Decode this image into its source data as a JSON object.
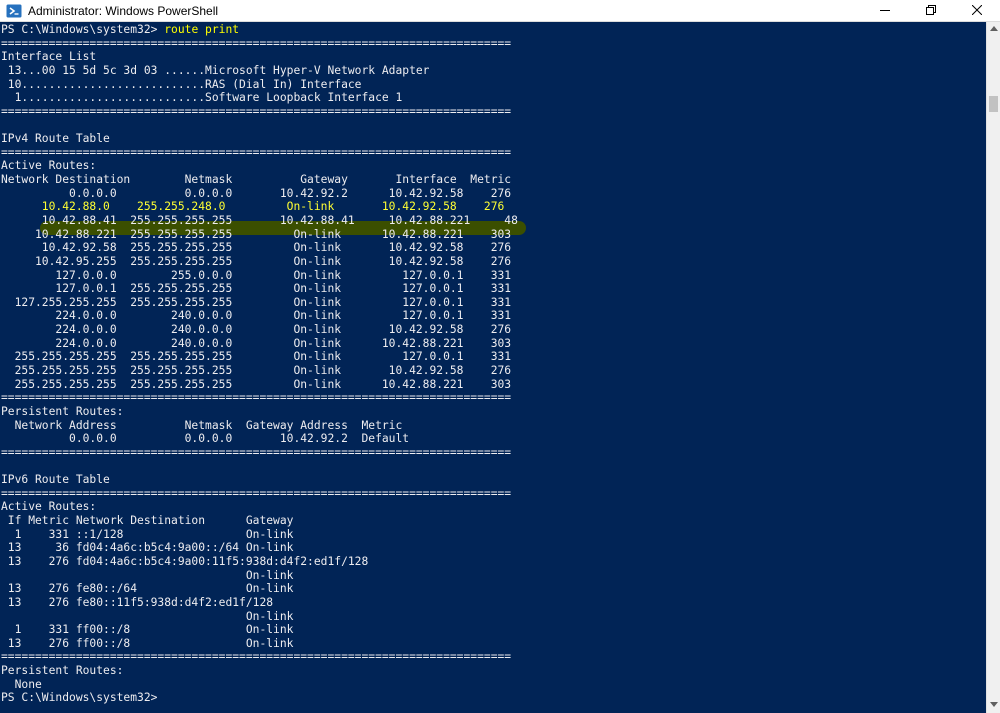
{
  "window": {
    "title": "Administrator: Windows PowerShell",
    "icon": "powershell-icon",
    "controls": [
      "minimize-icon",
      "maximize-icon",
      "close-icon"
    ]
  },
  "colors": {
    "console_bg": "#012456",
    "console_fg": "#eeedf0",
    "command": "#ffff00",
    "highlight_bg": "#3a4e00",
    "highlight_fg": "#ffff33"
  },
  "console": {
    "prompt": "PS C:\\Windows\\system32> ",
    "command": "route print",
    "highlighted_line": "      10.42.88.0    255.255.248.0         On-link       10.42.92.58    276",
    "lines": [
      "===========================================================================",
      "Interface List",
      " 13...00 15 5d 5c 3d 03 ......Microsoft Hyper-V Network Adapter",
      " 10...........................RAS (Dial In) Interface",
      "  1...........................Software Loopback Interface 1",
      "===========================================================================",
      "",
      "IPv4 Route Table",
      "===========================================================================",
      "Active Routes:",
      "Network Destination        Netmask          Gateway       Interface  Metric",
      "          0.0.0.0          0.0.0.0       10.42.92.2      10.42.92.58    276"
    ],
    "lines_after": [
      "      10.42.88.41  255.255.255.255       10.42.88.41     10.42.88.221     48",
      "     10.42.88.221  255.255.255.255         On-link      10.42.88.221    303",
      "      10.42.92.58  255.255.255.255         On-link       10.42.92.58    276",
      "     10.42.95.255  255.255.255.255         On-link       10.42.92.58    276",
      "        127.0.0.0        255.0.0.0         On-link         127.0.0.1    331",
      "        127.0.0.1  255.255.255.255         On-link         127.0.0.1    331",
      "  127.255.255.255  255.255.255.255         On-link         127.0.0.1    331",
      "        224.0.0.0        240.0.0.0         On-link         127.0.0.1    331",
      "        224.0.0.0        240.0.0.0         On-link       10.42.92.58    276",
      "        224.0.0.0        240.0.0.0         On-link      10.42.88.221    303",
      "  255.255.255.255  255.255.255.255         On-link         127.0.0.1    331",
      "  255.255.255.255  255.255.255.255         On-link       10.42.92.58    276",
      "  255.255.255.255  255.255.255.255         On-link      10.42.88.221    303",
      "===========================================================================",
      "Persistent Routes:",
      "  Network Address          Netmask  Gateway Address  Metric",
      "          0.0.0.0          0.0.0.0       10.42.92.2  Default",
      "===========================================================================",
      "",
      "IPv6 Route Table",
      "===========================================================================",
      "Active Routes:",
      " If Metric Network Destination      Gateway",
      "  1    331 ::1/128                  On-link",
      " 13     36 fd04:4a6c:b5c4:9a00::/64 On-link",
      " 13    276 fd04:4a6c:b5c4:9a00:11f5:938d:d4f2:ed1f/128",
      "                                    On-link",
      " 13    276 fe80::/64                On-link",
      " 13    276 fe80::11f5:938d:d4f2:ed1f/128",
      "                                    On-link",
      "  1    331 ff00::/8                 On-link",
      " 13    276 ff00::/8                 On-link",
      "===========================================================================",
      "Persistent Routes:",
      "  None"
    ],
    "final_prompt": "PS C:\\Windows\\system32>"
  }
}
